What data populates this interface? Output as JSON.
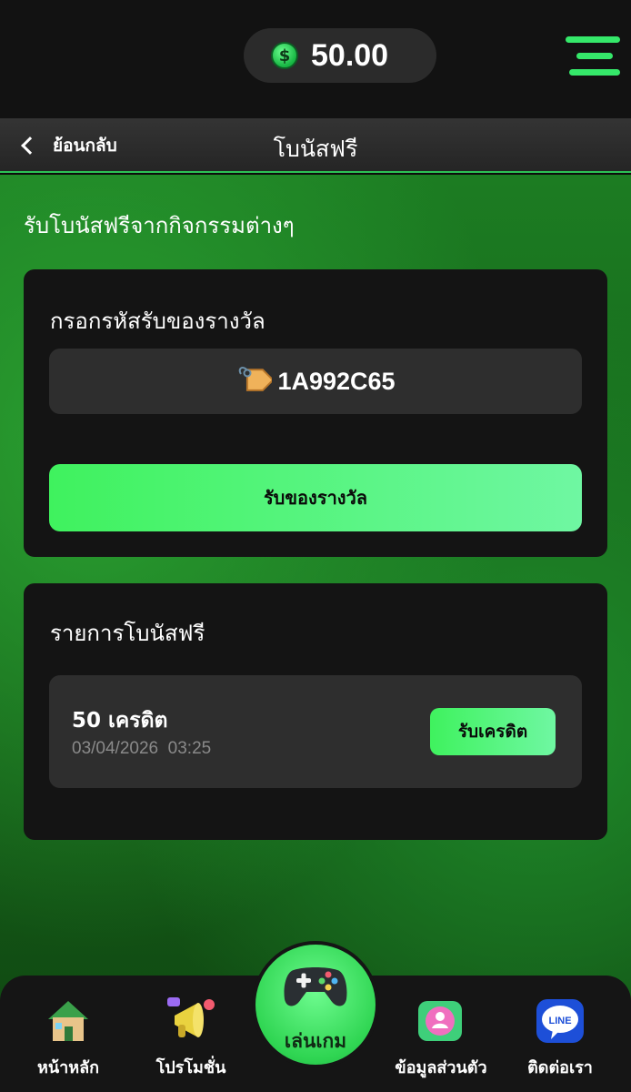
{
  "balance": {
    "currency_symbol": "$",
    "value": "50.00"
  },
  "header": {
    "back_label": "ย้อนกลับ",
    "title": "โบนัสฟรี"
  },
  "main": {
    "subtitle": "รับโบนัสฟรีจากกิจกรรมต่างๆ",
    "redeem": {
      "title": "กรอกรหัสรับของรางวัล",
      "code": "1A992C65",
      "button_label": "รับของรางวัล"
    },
    "bonus_list": {
      "title": "รายการโบนัสฟรี",
      "items": [
        {
          "amount": "50 เครดิต",
          "datetime": "03/04/2026  03:25",
          "button_label": "รับเครดิต"
        }
      ]
    }
  },
  "bottom_nav": {
    "home": "หน้าหลัก",
    "promotion": "โปรโมชั่น",
    "play": "เล่นเกม",
    "profile": "ข้อมูลส่วนตัว",
    "contact": "ติดต่อเรา",
    "line_text": "LINE"
  },
  "colors": {
    "accent_green": "#3ff25e",
    "background_dark": "#141414",
    "page_green": "#1c7c22"
  }
}
